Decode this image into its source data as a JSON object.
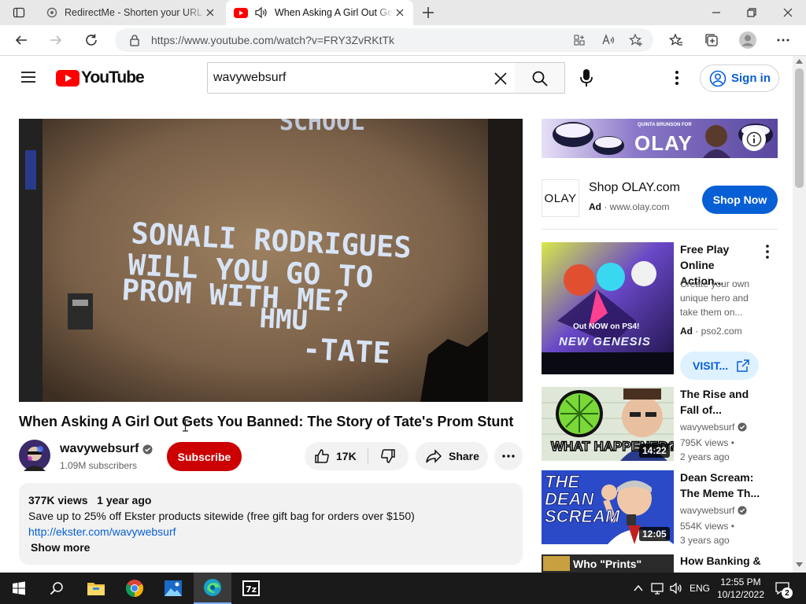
{
  "browser": {
    "tabs": [
      {
        "title": "RedirectMe - Shorten your URL f",
        "active": false
      },
      {
        "title": "When Asking A Girl Out Gets",
        "active": true
      }
    ],
    "url": "https://www.youtube.com/watch?v=FRY3ZvRKtTk"
  },
  "youtube": {
    "logo_text": "YouTube",
    "search_value": "wavywebsurf",
    "sign_in_label": "Sign in"
  },
  "video": {
    "frame_text": [
      "SONALI RODRIGUES",
      "WILL YOU GO TO",
      "PROM WITH ME?",
      "HMU",
      "-TATE",
      "SCHOOL"
    ],
    "title": "When Asking A Girl Out Gets You Banned: The Story of Tate's Prom Stunt",
    "channel_name": "wavywebsurf",
    "subscribers": "1.09M subscribers",
    "subscribe_label": "Subscribe",
    "likes": "17K",
    "share_label": "Share",
    "views": "377K views",
    "age": "1 year ago",
    "description_line": "Save up to 25% off Ekster products sitewide (free gift bag for orders over $150)",
    "description_link": "http://ekster.com/wavywebsurf",
    "show_more": "Show more"
  },
  "ads": {
    "banner_text": "OLAY",
    "banner_small": "QUINTA BRUNSON FOR",
    "brand_logo": "OLAY",
    "brand_title": "Shop OLAY.com",
    "ad_label": "Ad",
    "domain": "www.olay.com",
    "shop_now": "Shop Now",
    "game_title": "Free Play Online Action...",
    "game_desc": "Create your own unique hero and take them on...",
    "game_domain": "pso2.com",
    "visit_label": "VISIT...",
    "game_thumb_text": "Out NOW on PS4!",
    "game_thumb_logo": "NEW GENESIS"
  },
  "recommendations": [
    {
      "title": "The Rise and Fall of...",
      "channel": "wavywebsurf",
      "views": "795K views",
      "age": "2 years ago",
      "duration": "14:22",
      "thumb_text": "WHAT HAPPENED?"
    },
    {
      "title": "Dean Scream: The Meme Th...",
      "channel": "wavywebsurf",
      "views": "554K views",
      "age": "3 years ago",
      "duration": "12:05",
      "thumb_text": "THE DEAN SCREAM"
    },
    {
      "title": "How Banking &",
      "thumb_text": "Who \"Prints\""
    }
  ],
  "taskbar": {
    "language": "ENG",
    "time": "12:55 PM",
    "date": "10/12/2022",
    "notifications": "2"
  }
}
